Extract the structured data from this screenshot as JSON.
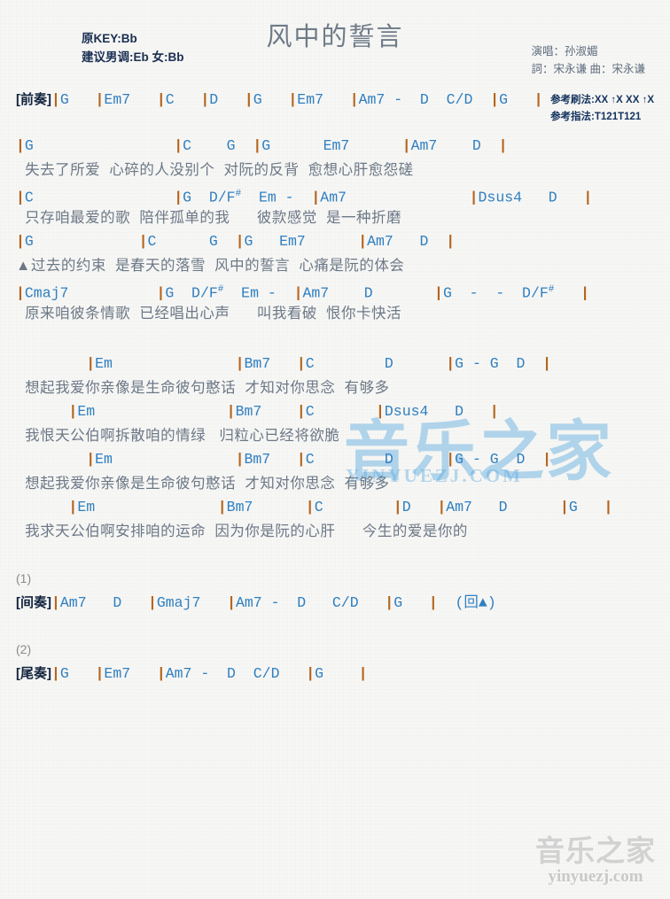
{
  "header": {
    "title": "风中的誓言",
    "key_original": "原KEY:Bb",
    "key_suggested": "建议男调:Eb 女:Bb",
    "singer": "演唱：孙淑媚",
    "writers": "詞：宋永谦  曲：宋永谦",
    "strum_pattern": "参考刷法:XX ↑X XX ↑X",
    "finger_pattern": "参考指法:T121T121"
  },
  "colors": {
    "chord": "#2f7fc1",
    "barline": "#b5651d",
    "lyric": "#6c7887",
    "title": "#6f7b88",
    "tag": "#12243f",
    "watermark_blue": "#4fa4de",
    "watermark_gray": "#d2d2d2"
  },
  "sections": {
    "intro": {
      "tag": "[前奏]",
      "chords": "|G   |Em7   |C   |D   |G   |Em7   |Am7 -  D  C/D  |G   |"
    },
    "verse": [
      {
        "chords": "|G                |C    G  |G      Em7      |Am7    D  |",
        "lyrics": "  失去了所爱  心碎的人没别个  对阮的反背  愈想心肝愈怨磋"
      },
      {
        "chords": "|C                |G  D/F#  Em -  |Am7              |Dsus4   D   |",
        "lyrics": "  只存咱最爱的歌  陪伴孤单的我      彼款感觉  是一种折磨"
      },
      {
        "chords": "|G            |C      G  |G   Em7      |Am7   D  |",
        "lyrics": "▲过去的约束  是春天的落雪  风中的誓言  心痛是阮的体会"
      },
      {
        "chords": "|Cmaj7          |G  D/F#  Em -  |Am7    D       |G  -  -  D/F#   |",
        "lyrics": "  原来咱彼条情歌  已经唱出心声      叫我看破  恨你卡快活"
      }
    ],
    "chorus": [
      {
        "chords": "        |Em              |Bm7   |C        D      |G - G  D  |",
        "lyrics": "  想起我爱你亲像是生命彼句憨话  才知对你思念  有够多"
      },
      {
        "chords": "      |Em               |Bm7    |C       |Dsus4   D   |",
        "lyrics": "  我恨天公伯啊拆散咱的情绿   归粒心已经将欲脆"
      },
      {
        "chords": "        |Em              |Bm7   |C        D      |G - G  D  |",
        "lyrics": "  想起我爱你亲像是生命彼句憨话  才知对你思念  有够多"
      },
      {
        "chords": "      |Em              |Bm7      |C        |D   |Am7   D      |G   |",
        "lyrics": "  我求天公伯啊安排咱的运命  因为你是阮的心肝      今生的爱是你的"
      }
    ],
    "interlude": {
      "marker": "(1)",
      "tag": "[间奏]",
      "chords": "|Am7   D   |Gmaj7   |Am7 -  D   C/D   |G   |  (回▲)"
    },
    "outro": {
      "marker": "(2)",
      "tag": "[尾奏]",
      "chords": "|G   |Em7   |Am7 -  D  C/D   |G    |"
    }
  },
  "watermarks": {
    "center_cn": "音乐之家",
    "center_en": "YINYUEZJ.COM",
    "corner_cn": "音乐之家",
    "corner_en": "yinyuezj.com"
  }
}
